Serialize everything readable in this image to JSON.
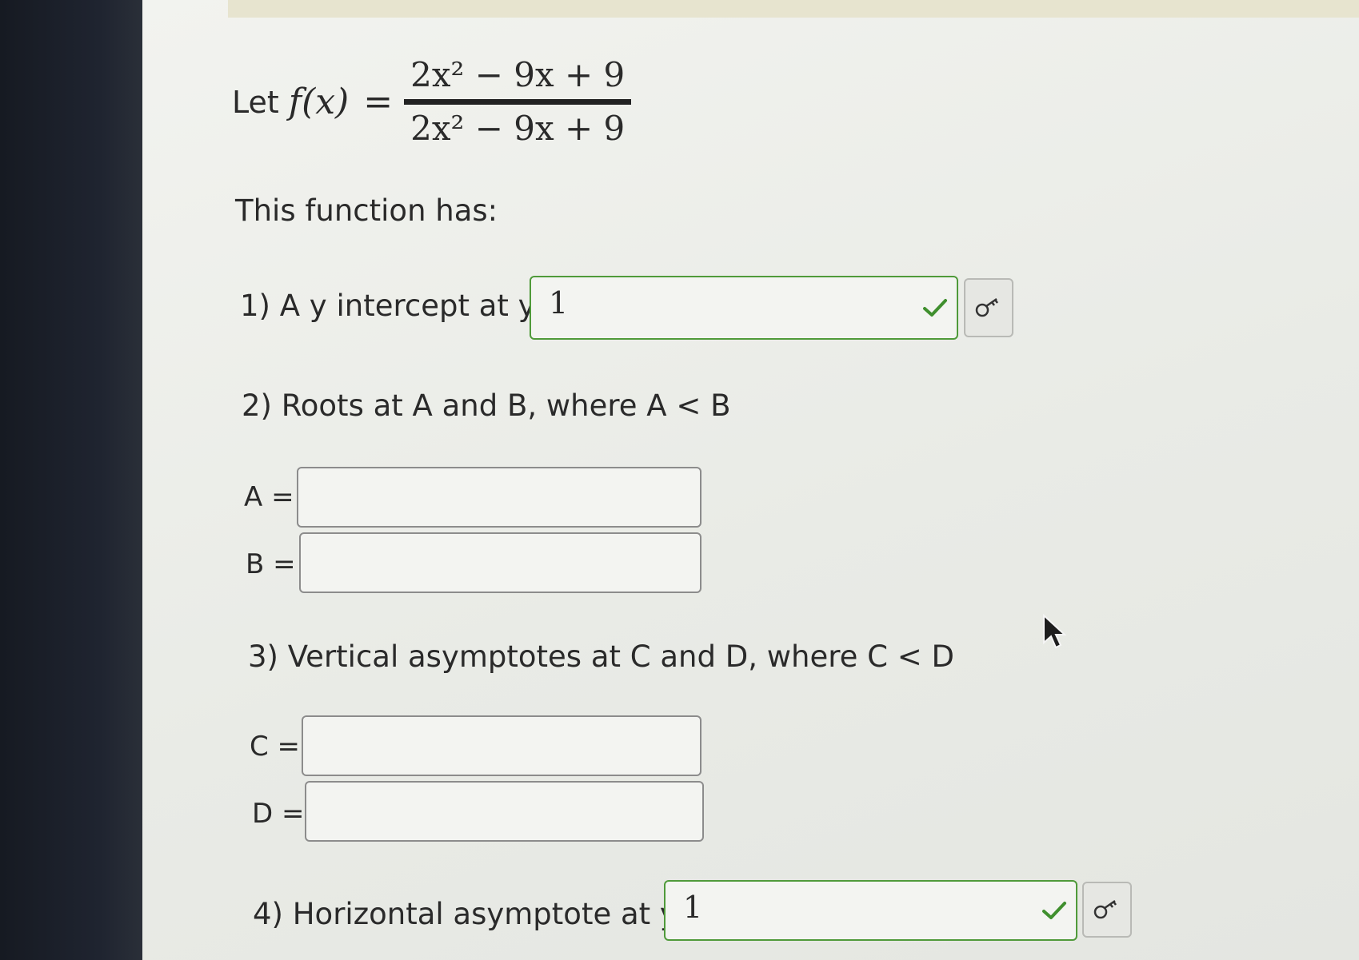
{
  "problem": {
    "let_prefix": "Let",
    "function_name": "f(x)",
    "equals": "=",
    "numerator": "2x² − 9x + 9",
    "denominator": "2x² − 9x + 9",
    "intro": "This function has:"
  },
  "q1": {
    "label": "1) A y intercept at y=",
    "value": "1",
    "status": "correct",
    "key_icon": "key-icon"
  },
  "q2": {
    "label": "2) Roots at A and B, where A < B",
    "a_label": "A =",
    "a_value": "",
    "b_label": "B =",
    "b_value": ""
  },
  "q3": {
    "label": "3) Vertical asymptotes at C and D, where C < D",
    "c_label": "C =",
    "c_value": "",
    "d_label": "D =",
    "d_value": ""
  },
  "q4": {
    "label": "4) Horizontal asymptote at y =",
    "value": "1",
    "status": "correct",
    "key_icon": "key-icon"
  },
  "colors": {
    "correct_border": "#4f9a3a",
    "check": "#3f8f2e",
    "text": "#2a2a2a"
  }
}
